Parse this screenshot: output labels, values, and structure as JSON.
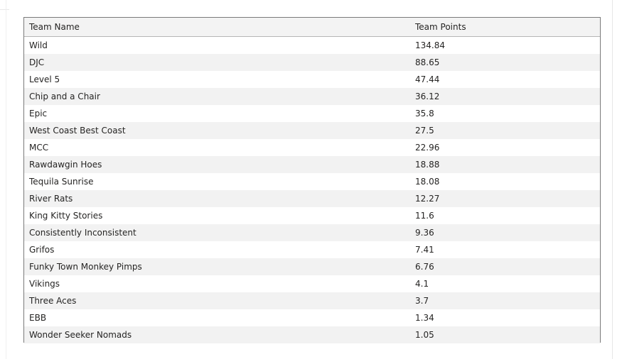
{
  "table": {
    "headers": [
      "Team Name",
      "Team Points"
    ],
    "rows": [
      [
        "Wild",
        "134.84"
      ],
      [
        "DJC",
        "88.65"
      ],
      [
        "Level 5",
        "47.44"
      ],
      [
        "Chip and a Chair",
        "36.12"
      ],
      [
        "Epic",
        "35.8"
      ],
      [
        "West Coast Best Coast",
        "27.5"
      ],
      [
        "MCC",
        "22.96"
      ],
      [
        "Rawdawgin Hoes",
        "18.88"
      ],
      [
        "Tequila Sunrise",
        "18.08"
      ],
      [
        "River Rats",
        "12.27"
      ],
      [
        "King Kitty Stories",
        "11.6"
      ],
      [
        "Consistently Inconsistent",
        "9.36"
      ],
      [
        "Grifos",
        "7.41"
      ],
      [
        "Funky Town Monkey Pimps",
        "6.76"
      ],
      [
        "Vikings",
        "4.1"
      ],
      [
        "Three Aces",
        "3.7"
      ],
      [
        "EBB",
        "1.34"
      ],
      [
        "Wonder Seeker Nomads",
        "1.05"
      ]
    ]
  }
}
